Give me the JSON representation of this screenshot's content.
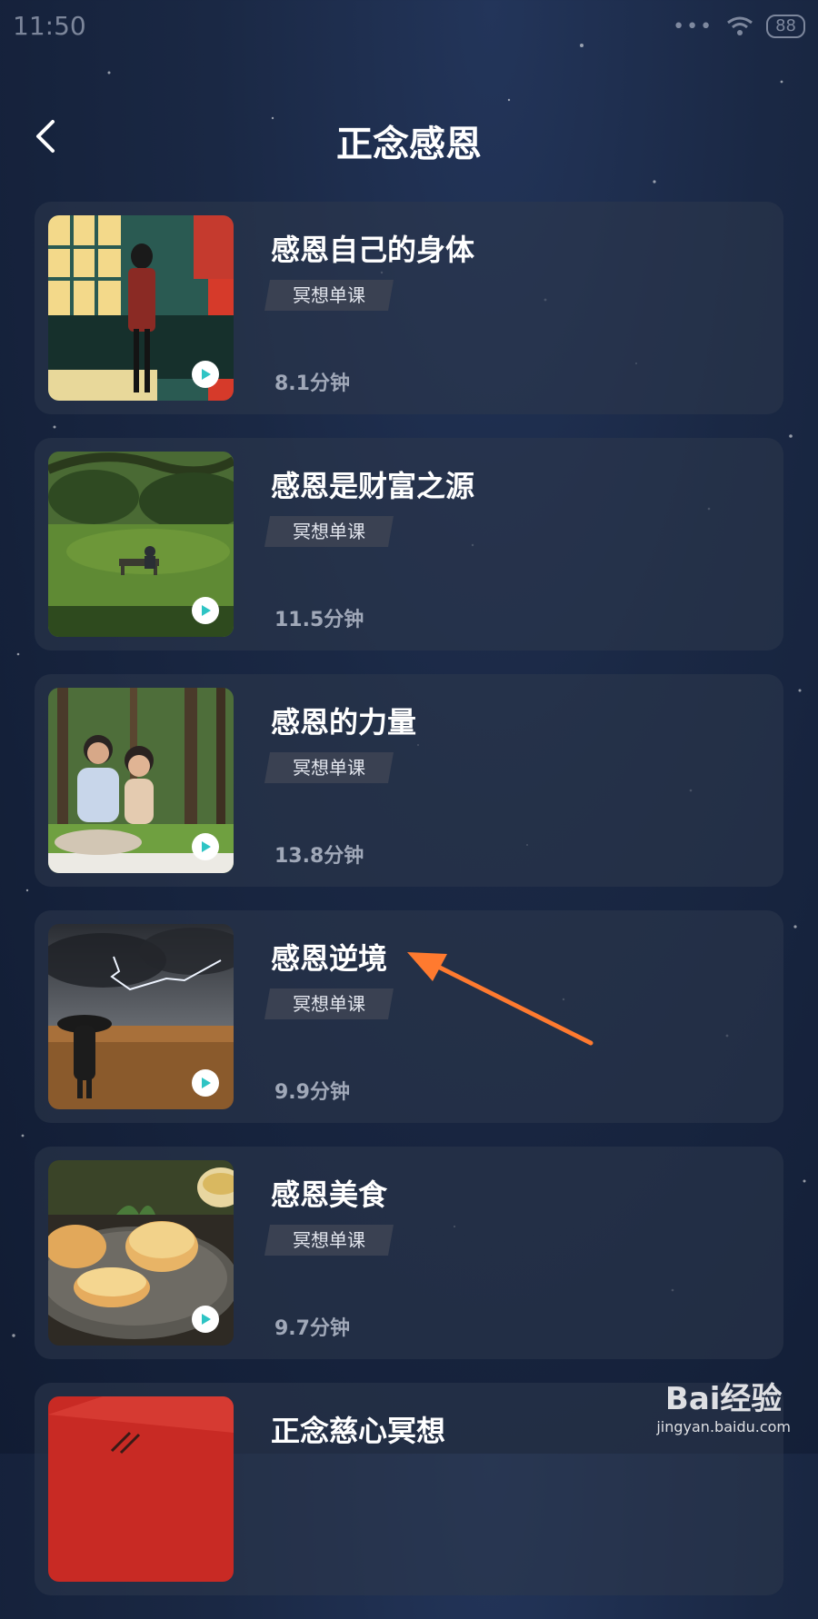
{
  "status_bar": {
    "time": "11:50",
    "dots": "•••",
    "battery": "88"
  },
  "header": {
    "title": "正念感恩",
    "back_icon": "chevron-left-icon"
  },
  "courses": [
    {
      "title": "感恩自己的身体",
      "tag": "冥想单课",
      "duration": "8.1分钟"
    },
    {
      "title": "感恩是财富之源",
      "tag": "冥想单课",
      "duration": "11.5分钟"
    },
    {
      "title": "感恩的力量",
      "tag": "冥想单课",
      "duration": "13.8分钟"
    },
    {
      "title": "感恩逆境",
      "tag": "冥想单课",
      "duration": "9.9分钟"
    },
    {
      "title": "感恩美食",
      "tag": "冥想单课",
      "duration": "9.7分钟"
    },
    {
      "title": "正念慈心冥想",
      "tag": "",
      "duration": ""
    }
  ],
  "annotation": {
    "color": "#ff7a2f"
  },
  "watermark": {
    "logo": "Bai经验",
    "url": "jingyan.baidu.com"
  },
  "colors": {
    "play_accent": "#2ec4c4",
    "card_bg": "#2e384c"
  }
}
